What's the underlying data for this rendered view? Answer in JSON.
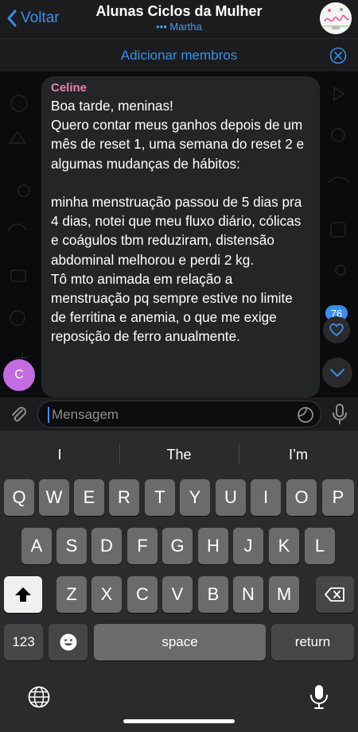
{
  "header": {
    "back_label": "Voltar",
    "title": "Alunas Ciclos da Mulher",
    "typing_indicator": "•••",
    "subtitle": "Martha"
  },
  "add_members": {
    "label": "Adicionar membros"
  },
  "message": {
    "sender": "Celine",
    "sender_initial": "C",
    "text": "Boa tarde, meninas!\nQuero contar meus ganhos depois de um mês de reset 1, uma semana do reset 2 e algumas mudanças de hábitos:\n\nminha menstruação passou de 5 dias pra 4 dias, notei que meu fluxo diário, cólicas e coágulos tbm reduziram, distensão abdominal melhorou e perdi 2 kg.\nTô mto animada em relação a menstruação pq sempre estive no limite de ferritina e anemia, o que me exige reposição de ferro anualmente.",
    "reaction_count": "76"
  },
  "input": {
    "placeholder": "Mensagem"
  },
  "keyboard": {
    "suggestions": [
      "I",
      "The",
      "I’m"
    ],
    "row1": [
      "Q",
      "W",
      "E",
      "R",
      "T",
      "Y",
      "U",
      "I",
      "O",
      "P"
    ],
    "row2": [
      "A",
      "S",
      "D",
      "F",
      "G",
      "H",
      "J",
      "K",
      "L"
    ],
    "row3": [
      "Z",
      "X",
      "C",
      "V",
      "B",
      "N",
      "M"
    ],
    "numbers_label": "123",
    "space_label": "space",
    "return_label": "return"
  },
  "colors": {
    "accent": "#3a8eea",
    "sender_name": "#ef7fb0",
    "sender_avatar": "#c36be0"
  }
}
